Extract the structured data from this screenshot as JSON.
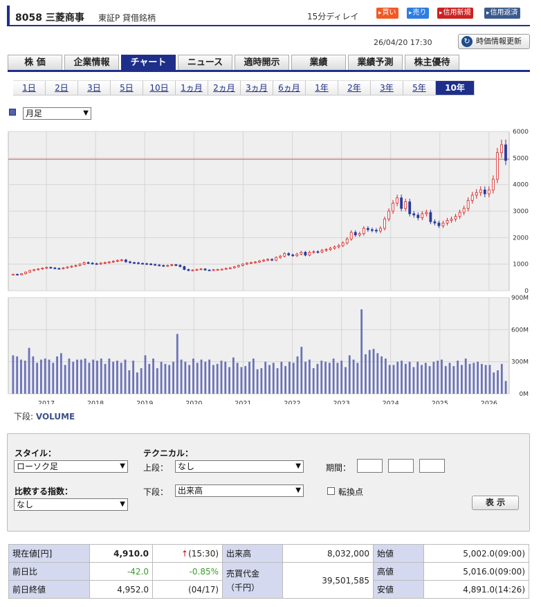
{
  "header": {
    "code_name": "8058 三菱商事",
    "market": "東証P 貸借銘柄",
    "delay": "15分ディレイ",
    "buttons": [
      {
        "label": "買い",
        "color": "#f15a24"
      },
      {
        "label": "売り",
        "color": "#2e7de1"
      },
      {
        "label": "信用新規",
        "color": "#cc2222"
      },
      {
        "label": "信用返済",
        "color": "#3b5b8c"
      }
    ]
  },
  "timestamp": "26/04/20 17:30",
  "refresh_label": "時価情報更新",
  "tabs": [
    {
      "label": "株 価",
      "active": false
    },
    {
      "label": "企業情報",
      "active": false
    },
    {
      "label": "チャート",
      "active": true
    },
    {
      "label": "ニュース",
      "active": false
    },
    {
      "label": "適時開示",
      "active": false
    },
    {
      "label": "業績",
      "active": false
    },
    {
      "label": "業績予測",
      "active": false
    },
    {
      "label": "株主優待",
      "active": false
    }
  ],
  "periods": [
    "1日",
    "2日",
    "3日",
    "5日",
    "10日",
    "1ヵ月",
    "2ヵ月",
    "3ヵ月",
    "6ヵ月",
    "1年",
    "2年",
    "3年",
    "5年",
    "10年"
  ],
  "active_period": "10年",
  "interval_select": "月足",
  "volume_label_prefix": "下段:",
  "volume_label": "VOLUME",
  "chart_data": [
    {
      "type": "candlestick",
      "title": "",
      "x_labels": [
        "2017",
        "2018",
        "2019",
        "2020",
        "2021",
        "2022",
        "2023",
        "2024",
        "2025",
        "2026"
      ],
      "yticks": [
        "6000",
        "5000",
        "4000",
        "3000",
        "2000",
        "1000",
        "0"
      ],
      "ylim": [
        0,
        6000
      ],
      "reference_line": 4952,
      "up_color": "#d92020",
      "down_color": "#2a3b9b",
      "close": [
        620,
        600,
        640,
        700,
        760,
        790,
        820,
        850,
        880,
        860,
        840,
        830,
        860,
        890,
        920,
        950,
        1000,
        1060,
        1040,
        1020,
        1010,
        1040,
        1060,
        1080,
        1110,
        1140,
        1160,
        1090,
        1060,
        1050,
        1030,
        1020,
        1010,
        990,
        970,
        950,
        930,
        950,
        980,
        960,
        910,
        800,
        760,
        780,
        800,
        820,
        780,
        770,
        790,
        800,
        810,
        840,
        860,
        900,
        950,
        1000,
        1040,
        1060,
        1080,
        1120,
        1150,
        1180,
        1150,
        1250,
        1300,
        1400,
        1350,
        1320,
        1380,
        1450,
        1340,
        1450,
        1470,
        1460,
        1520,
        1550,
        1600,
        1650,
        1700,
        1800,
        1950,
        2200,
        2100,
        2150,
        2350,
        2300,
        2280,
        2250,
        2350,
        2700,
        3000,
        3300,
        3500,
        3100,
        3350,
        2900,
        2850,
        2750,
        2900,
        2950,
        2600,
        2550,
        2450,
        2550,
        2650,
        2700,
        2800,
        2950,
        3100,
        3400,
        3600,
        3700,
        3800,
        3650,
        3800,
        4200,
        5200,
        5500,
        4910
      ],
      "volume": {
        "yticks": [
          "900M",
          "600M",
          "300M",
          "0M"
        ],
        "ylim": [
          0,
          900
        ],
        "values": [
          360,
          350,
          320,
          310,
          430,
          350,
          290,
          320,
          330,
          320,
          290,
          350,
          380,
          270,
          330,
          300,
          320,
          320,
          330,
          290,
          320,
          310,
          330,
          280,
          330,
          300,
          310,
          290,
          320,
          220,
          310,
          200,
          240,
          360,
          280,
          330,
          240,
          300,
          280,
          270,
          300,
          560,
          320,
          300,
          270,
          330,
          290,
          320,
          300,
          320,
          270,
          280,
          310,
          300,
          250,
          340,
          290,
          250,
          260,
          300,
          330,
          230,
          240,
          300,
          270,
          290,
          240,
          300,
          260,
          300,
          290,
          350,
          440,
          300,
          320,
          240,
          280,
          310,
          300,
          290,
          330,
          290,
          310,
          250,
          360,
          320,
          290,
          790,
          370,
          410,
          420,
          380,
          350,
          330,
          270,
          270,
          300,
          310,
          280,
          300,
          250,
          300,
          270,
          290,
          260,
          300,
          310,
          320,
          260,
          290,
          260,
          310,
          270,
          330,
          280,
          290,
          300,
          280,
          270,
          270,
          200,
          220,
          280,
          120
        ]
      }
    }
  ],
  "panel": {
    "style_label": "スタイル：",
    "style_value": "ローソク足",
    "technical_label": "テクニカル：",
    "upper_label": "上段：",
    "upper_value": "なし",
    "period_label": "期間：",
    "compare_label": "比較する指数：",
    "compare_value": "なし",
    "lower_label": "下段：",
    "lower_value": "出来高",
    "turning_label": "転換点",
    "submit_label": "表 示"
  },
  "quote": {
    "current_label": "現在値[円]",
    "current_value": "4,910.0",
    "current_time": "(15:30)",
    "change_label": "前日比",
    "change_value": "-42.0",
    "change_pct": "-0.85%",
    "prev_label": "前日終値",
    "prev_value": "4,952.0",
    "prev_date": "(04/17)",
    "volume_label": "出来高",
    "volume_value": "8,032,000",
    "turnover_label": "売買代金\n（千円）",
    "turnover_value": "39,501,585",
    "open_label": "始値",
    "open_value": "5,002.0(09:00)",
    "high_label": "高値",
    "high_value": "5,016.0(09:00)",
    "low_label": "安値",
    "low_value": "4,891.0(14:26)"
  }
}
